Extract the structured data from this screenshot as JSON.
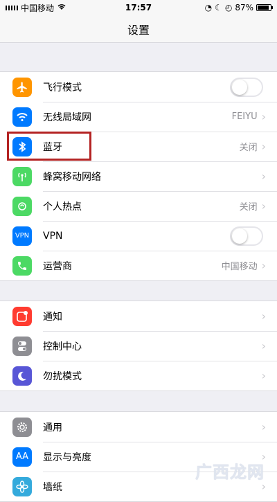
{
  "status_bar": {
    "carrier": "中国移动",
    "time": "17:57",
    "battery": "87%"
  },
  "nav": {
    "title": "设置"
  },
  "groups": [
    [
      {
        "icon": "airplane-icon",
        "color": "#ff9500",
        "label": "飞行模式",
        "toggle": false
      },
      {
        "icon": "wifi-icon",
        "color": "#007aff",
        "label": "无线局域网",
        "value": "FEIYU"
      },
      {
        "icon": "bluetooth-icon",
        "color": "#007aff",
        "label": "蓝牙",
        "value": "关闭"
      },
      {
        "icon": "cellular-icon",
        "color": "#4cd964",
        "label": "蜂窝移动网络"
      },
      {
        "icon": "hotspot-icon",
        "color": "#4cd964",
        "label": "个人热点",
        "value": "关闭"
      },
      {
        "icon": "vpn-icon",
        "color": "#007aff",
        "label": "VPN",
        "icon_text": "VPN",
        "toggle": false
      },
      {
        "icon": "phone-icon",
        "color": "#4cd964",
        "label": "运营商",
        "value": "中国移动"
      }
    ],
    [
      {
        "icon": "notifications-icon",
        "color": "#ff3b30",
        "label": "通知"
      },
      {
        "icon": "control-center-icon",
        "color": "#8e8e93",
        "label": "控制中心"
      },
      {
        "icon": "do-not-disturb-icon",
        "color": "#5856d6",
        "label": "勿扰模式"
      }
    ],
    [
      {
        "icon": "gear-icon",
        "color": "#8e8e93",
        "label": "通用"
      },
      {
        "icon": "display-icon",
        "color": "#007aff",
        "label": "显示与亮度",
        "icon_text": "AA"
      },
      {
        "icon": "wallpaper-icon",
        "color": "#34aadc",
        "label": "墙纸"
      }
    ]
  ],
  "watermark": "广西龙网"
}
